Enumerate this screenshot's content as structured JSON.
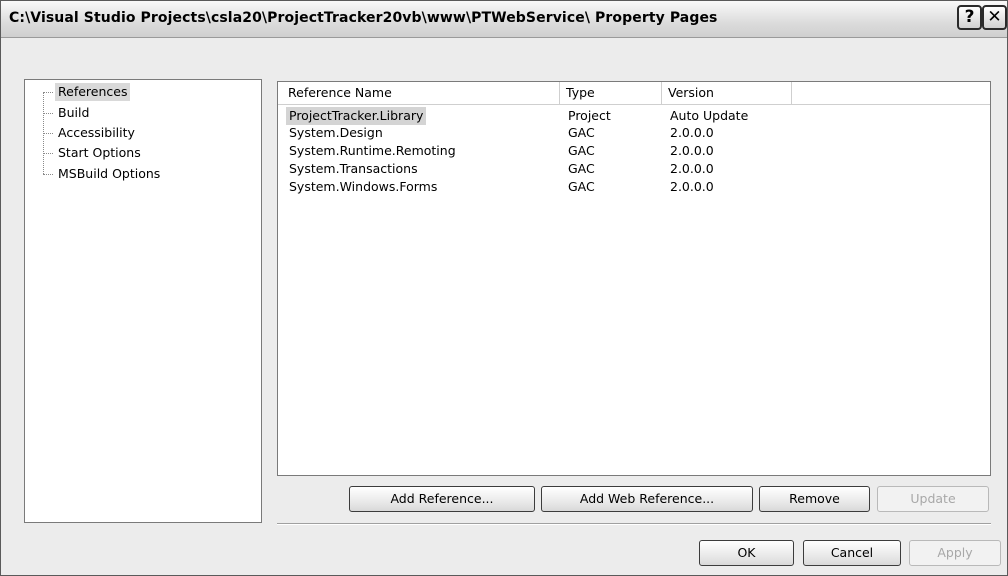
{
  "window": {
    "title": "C:\\Visual Studio Projects\\csla20\\ProjectTracker20vb\\www\\PTWebService\\ Property Pages",
    "help_glyph": "?",
    "close_glyph": "✕"
  },
  "tree": {
    "items": [
      {
        "label": "References",
        "selected": true
      },
      {
        "label": "Build"
      },
      {
        "label": "Accessibility"
      },
      {
        "label": "Start Options"
      },
      {
        "label": "MSBuild Options"
      }
    ]
  },
  "references": {
    "columns": [
      "Reference Name",
      "Type",
      "Version"
    ],
    "rows": [
      {
        "name": "ProjectTracker.Library",
        "type": "Project",
        "version": "Auto Update",
        "selected": true
      },
      {
        "name": "System.Design",
        "type": "GAC",
        "version": "2.0.0.0"
      },
      {
        "name": "System.Runtime.Remoting",
        "type": "GAC",
        "version": "2.0.0.0"
      },
      {
        "name": "System.Transactions",
        "type": "GAC",
        "version": "2.0.0.0"
      },
      {
        "name": "System.Windows.Forms",
        "type": "GAC",
        "version": "2.0.0.0"
      }
    ]
  },
  "buttons": {
    "add_reference": "Add Reference...",
    "add_web_reference": "Add Web Reference...",
    "remove": "Remove",
    "update": "Update",
    "ok": "OK",
    "cancel": "Cancel",
    "apply": "Apply"
  }
}
